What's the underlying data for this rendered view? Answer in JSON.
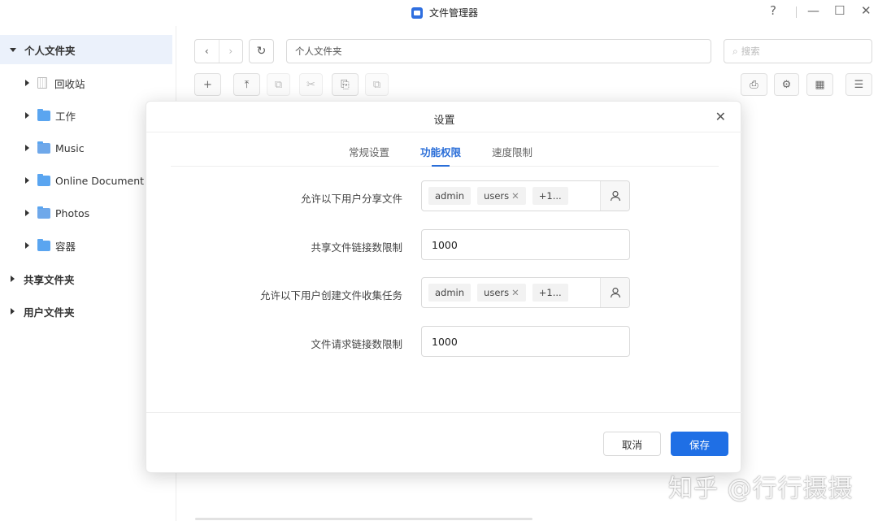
{
  "window": {
    "title": "文件管理器",
    "help": "?",
    "minimize": "—",
    "maximize": "☐",
    "close": "✕"
  },
  "sidebar": {
    "items": [
      {
        "label": "个人文件夹",
        "icon": "folder-open-arrow"
      },
      {
        "label": "回收站",
        "icon": "trash-icon"
      },
      {
        "label": "工作",
        "icon": "folder-icon"
      },
      {
        "label": "Music",
        "icon": "music-folder-icon"
      },
      {
        "label": "Online Document",
        "icon": "folder-icon"
      },
      {
        "label": "Photos",
        "icon": "photos-folder-icon"
      },
      {
        "label": "容器",
        "icon": "folder-icon"
      },
      {
        "label": "共享文件夹",
        "icon": "collapsed-arrow"
      },
      {
        "label": "用户文件夹",
        "icon": "collapsed-arrow"
      }
    ]
  },
  "toolbar": {
    "back": "‹",
    "forward": "›",
    "refresh": "↻",
    "path": "个人文件夹",
    "search_placeholder": "搜索",
    "new": "+",
    "upload": "⤒",
    "copy": "⧉",
    "cut": "✂",
    "paste": "⎘",
    "share": "⧉",
    "print": "⎙",
    "settings": "⚙",
    "view": "▦",
    "sort": "☰"
  },
  "dialog": {
    "title": "设置",
    "close": "✕",
    "tabs": [
      "常规设置",
      "功能权限",
      "速度限制"
    ],
    "active_tab": "功能权限",
    "fields": [
      {
        "label": "允许以下用户分享文件",
        "tags": [
          "admin",
          "users",
          "+1..."
        ],
        "tag_removable": [
          false,
          true,
          false
        ]
      },
      {
        "label": "共享文件链接数限制",
        "value": "1000"
      },
      {
        "label": "允许以下用户创建文件收集任务",
        "tags": [
          "admin",
          "users",
          "+1..."
        ],
        "tag_removable": [
          false,
          true,
          false
        ]
      },
      {
        "label": "文件请求链接数限制",
        "value": "1000"
      }
    ],
    "cancel_label": "取消",
    "save_label": "保存"
  },
  "watermark": "知乎 @行行摄摄",
  "colors": {
    "accent": "#1f6fe5",
    "folder": "#5aa5f0",
    "sidebar_selected": "#ebf1fb"
  }
}
